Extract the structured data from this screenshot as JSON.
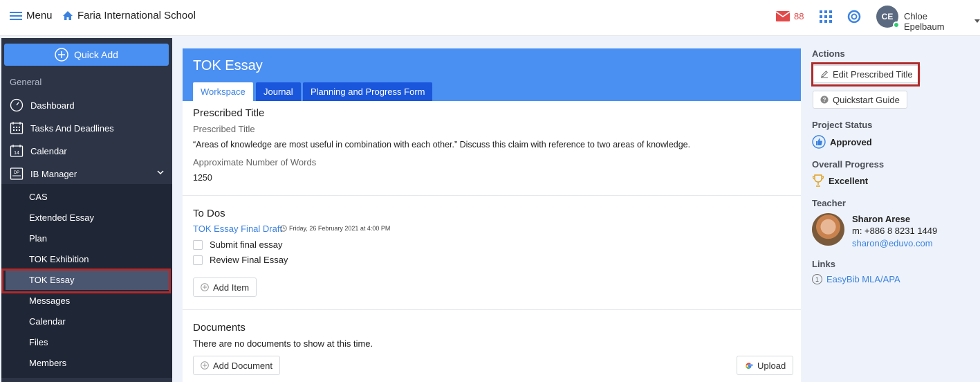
{
  "topbar": {
    "menu_label": "Menu",
    "school_name": "Faria International School",
    "mail_count": "88",
    "avatar_initials": "CE",
    "user_name": "Chloe Epelbaum"
  },
  "sidebar": {
    "quick_add_label": "Quick Add",
    "section_general": "General",
    "items": [
      {
        "label": "Dashboard",
        "icon": "dashboard-icon"
      },
      {
        "label": "Tasks And Deadlines",
        "icon": "calendar-grid-icon"
      },
      {
        "label": "Calendar",
        "icon": "calendar-icon"
      },
      {
        "label": "IB Manager",
        "icon": "dp-icon"
      }
    ],
    "calendar_icon_text": "14",
    "dp_icon_text": "DP",
    "sub_items": [
      {
        "label": "CAS"
      },
      {
        "label": "Extended Essay"
      },
      {
        "label": "Plan"
      },
      {
        "label": "TOK Exhibition"
      },
      {
        "label": "TOK Essay"
      },
      {
        "label": "Messages"
      },
      {
        "label": "Calendar"
      },
      {
        "label": "Files"
      },
      {
        "label": "Members"
      }
    ]
  },
  "main": {
    "title": "TOK Essay",
    "tabs": [
      {
        "label": "Workspace"
      },
      {
        "label": "Journal"
      },
      {
        "label": "Planning and Progress Form"
      }
    ],
    "prescribed": {
      "heading": "Prescribed Title",
      "label": "Prescribed Title",
      "value": "“Areas of knowledge are most useful in combination with each other.” Discuss this claim with reference to two areas of knowledge.",
      "words_label": "Approximate Number of Words",
      "words_value": "1250"
    },
    "todos": {
      "heading": "To Dos",
      "link": "TOK Essay Final Draft",
      "date": "Friday, 26 February 2021 at 4:00 PM",
      "items": [
        {
          "label": "Submit final essay"
        },
        {
          "label": "Review Final Essay"
        }
      ],
      "add_item_label": "Add Item"
    },
    "documents": {
      "heading": "Documents",
      "empty_text": "There are no documents to show at this time.",
      "add_document_label": "Add Document",
      "upload_label": "Upload"
    }
  },
  "right_panel": {
    "actions_heading": "Actions",
    "edit_title_label": "Edit Prescribed Title",
    "quickstart_label": "Quickstart Guide",
    "status_heading": "Project Status",
    "status_value": "Approved",
    "progress_heading": "Overall Progress",
    "progress_value": "Excellent",
    "teacher_heading": "Teacher",
    "teacher_name": "Sharon Arese",
    "teacher_phone": "m: +886 8 8231 1449",
    "teacher_email": "sharon@eduvo.com",
    "links_heading": "Links",
    "link_number": "1",
    "link_label": "EasyBib MLA/APA"
  },
  "colors": {
    "accent": "#4a8ff2",
    "tab_dark": "#1a56db",
    "sidebar_bg": "#2c3446",
    "highlight": "#b02a2a",
    "mail": "#e24a4a"
  }
}
